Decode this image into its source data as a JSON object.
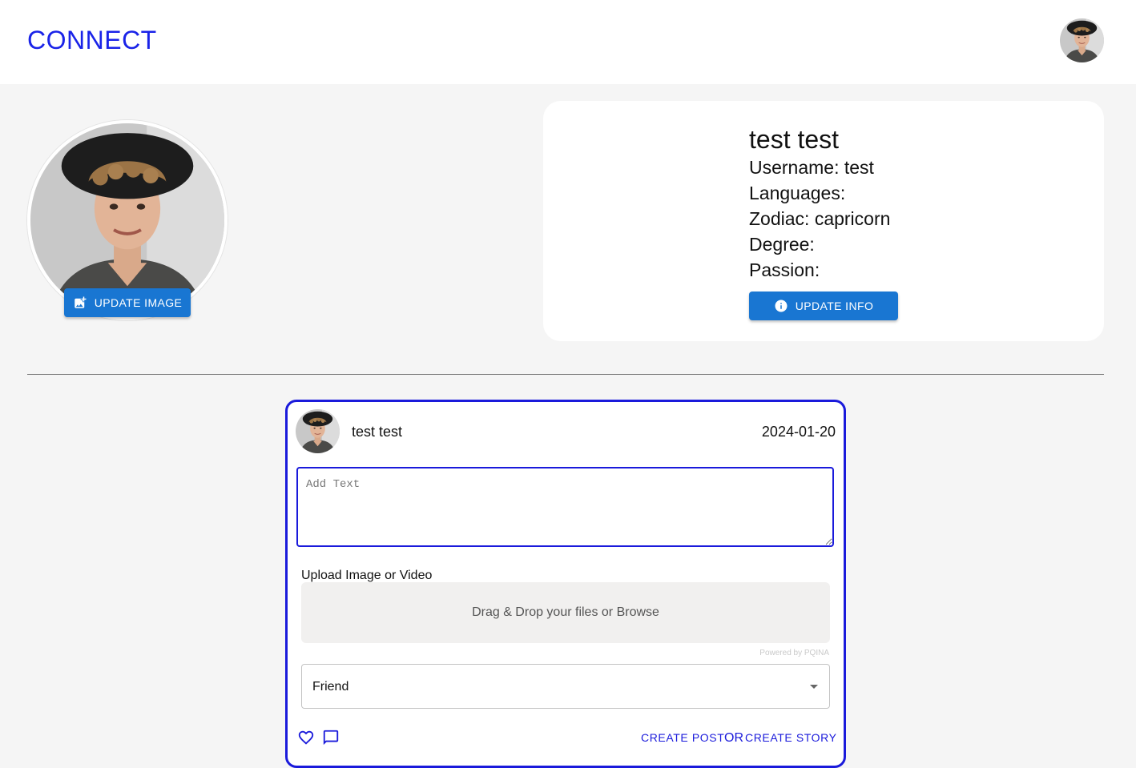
{
  "app": {
    "brand": "CONNECT"
  },
  "profile": {
    "update_image_label": "UPDATE IMAGE",
    "full_name": "test test",
    "username_line": "Username: test",
    "languages_line": "Languages:",
    "zodiac_line": "Zodiac: capricorn",
    "degree_line": "Degree:",
    "passion_line": "Passion:",
    "update_info_label": "UPDATE INFO"
  },
  "composer": {
    "user_name": "test test",
    "date": "2024-01-20",
    "text_placeholder": "Add Text",
    "upload_label": "Upload Image or Video",
    "dropzone_text": "Drag & Drop your files or Browse",
    "powered_by": "Powered by PQINA",
    "audience_value": "Friend",
    "create_post_label": "CREATE POST",
    "or_label": "OR",
    "create_story_label": "CREATE STORY"
  },
  "colors": {
    "brand": "#1a23e8",
    "button_blue": "#1976d2",
    "card_border": "#1a1adb",
    "background": "#f5f5f5"
  },
  "icons": {
    "update_image": "add-photo-icon",
    "update_info": "info-icon",
    "like": "heart-outline-icon",
    "comment": "comment-icon",
    "select_caret": "caret-down-icon"
  }
}
